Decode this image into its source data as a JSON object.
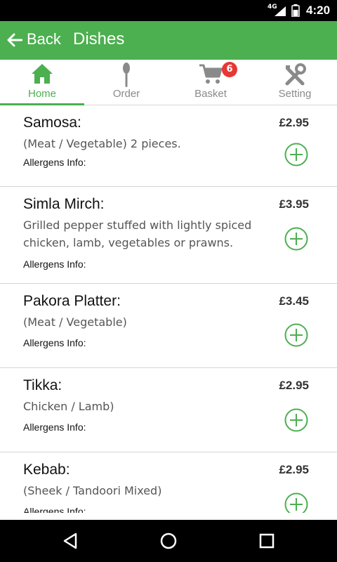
{
  "status_bar": {
    "network": "4G",
    "time": "4:20"
  },
  "app_bar": {
    "back_label": "Back",
    "title": "Dishes"
  },
  "tabs": [
    {
      "label": "Home",
      "icon": "home-icon",
      "active": true
    },
    {
      "label": "Order",
      "icon": "spoon-icon",
      "active": false
    },
    {
      "label": "Basket",
      "icon": "cart-icon",
      "active": false,
      "badge": "6"
    },
    {
      "label": "Setting",
      "icon": "tools-icon",
      "active": false
    }
  ],
  "dishes": [
    {
      "name": "Samosa:",
      "description": "(Meat / Vegetable) 2 pieces.",
      "allergens": "Allergens Info:",
      "price": "£2.95"
    },
    {
      "name": "Simla Mirch:",
      "description": "Grilled pepper stuffed with lightly spiced chicken, lamb, vegetables or prawns.",
      "allergens": "Allergens Info:",
      "price": "£3.95"
    },
    {
      "name": "Pakora Platter:",
      "description": "(Meat / Vegetable)",
      "allergens": "Allergens Info:",
      "price": "£3.45"
    },
    {
      "name": "Tikka:",
      "description": "Chicken / Lamb)",
      "allergens": "Allergens Info:",
      "price": "£2.95"
    },
    {
      "name": "Kebab:",
      "description": "(Sheek / Tandoori Mixed)",
      "allergens": "Allergens Info:",
      "price": "£2.95"
    }
  ],
  "colors": {
    "accent": "#4caf50",
    "badge": "#e53935",
    "status_bar": "#000000"
  }
}
